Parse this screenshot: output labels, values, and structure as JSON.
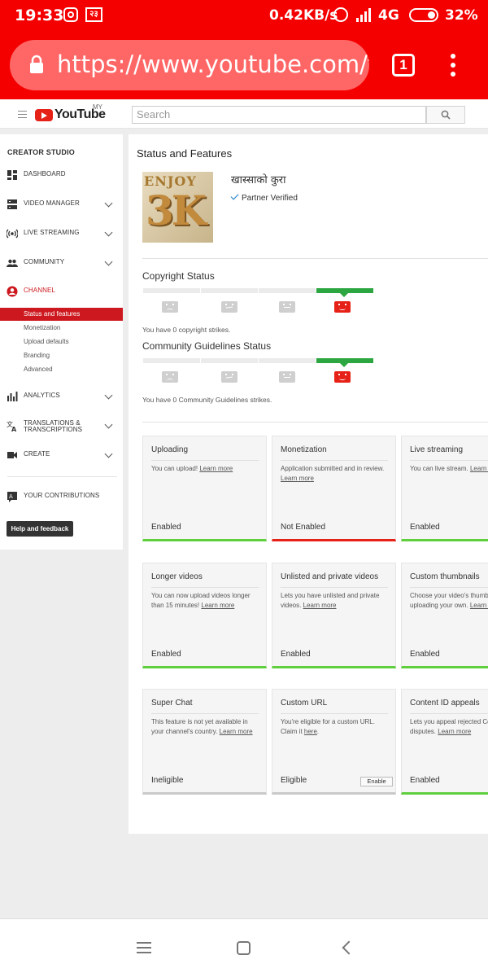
{
  "status_bar": {
    "time": "19:33",
    "carrier_badge": "२३",
    "speed": "0.42KB/s",
    "network": "4G",
    "battery": "32%"
  },
  "browser": {
    "url": "https://www.youtube.com/features",
    "tab_count": "1"
  },
  "yt_header": {
    "logo": "YouTube",
    "region": "MY",
    "search_placeholder": "Search"
  },
  "sidebar": {
    "title": "CREATOR STUDIO",
    "items": [
      {
        "label": "DASHBOARD",
        "icon": "dashboard-icon"
      },
      {
        "label": "VIDEO MANAGER",
        "icon": "video-manager-icon"
      },
      {
        "label": "LIVE STREAMING",
        "icon": "live-icon"
      },
      {
        "label": "COMMUNITY",
        "icon": "community-icon"
      },
      {
        "label": "CHANNEL",
        "icon": "channel-icon"
      },
      {
        "label": "ANALYTICS",
        "icon": "analytics-icon"
      },
      {
        "label": "TRANSLATIONS & TRANSCRIPTIONS",
        "icon": "translate-icon"
      },
      {
        "label": "CREATE",
        "icon": "create-icon"
      },
      {
        "label": "YOUR CONTRIBUTIONS",
        "icon": "contributions-icon"
      }
    ],
    "channel_sub": [
      "Status and features",
      "Monetization",
      "Upload defaults",
      "Branding",
      "Advanced"
    ],
    "help_button": "Help and feedback"
  },
  "main": {
    "title": "Status and Features",
    "avatar_text": {
      "big": "3K",
      "small": "ENJOY"
    },
    "channel_name": "खास्साको कुरा",
    "verified_label": "Partner Verified",
    "copyright": {
      "title": "Copyright Status",
      "note": "You have 0 copyright strikes."
    },
    "community": {
      "title": "Community Guidelines Status",
      "note": "You have 0 Community Guidelines strikes."
    },
    "cards": [
      {
        "title": "Uploading",
        "desc": "You can upload!",
        "link": "Learn more",
        "status": "Enabled",
        "state": "green"
      },
      {
        "title": "Monetization",
        "desc": "Application submitted and in review.",
        "link": "Learn more",
        "status": "Not Enabled",
        "state": "red"
      },
      {
        "title": "Live streaming",
        "desc": "You can live stream.",
        "link": "Learn more",
        "status": "Enabled",
        "state": "green"
      },
      {
        "title": "Longer videos",
        "desc": "You can now upload videos longer than 15 minutes!",
        "link": "Learn more",
        "status": "Enabled",
        "state": "green"
      },
      {
        "title": "Unlisted and private videos",
        "desc": "Lets you have unlisted and private videos.",
        "link": "Learn more",
        "status": "Enabled",
        "state": "green"
      },
      {
        "title": "Custom thumbnails",
        "desc": "Choose your video's thumbnail by uploading your own.",
        "link": "Learn more",
        "status": "Enabled",
        "state": "green"
      },
      {
        "title": "Super Chat",
        "desc": "This feature is not yet available in your channel's country.",
        "link": "Learn more",
        "status": "Ineligible",
        "state": "grey"
      },
      {
        "title": "Custom URL",
        "desc": "You're eligible for a custom URL. Claim it",
        "link": "here",
        "status": "Eligible",
        "state": "grey",
        "button": "Enable"
      },
      {
        "title": "Content ID appeals",
        "desc": "Lets you appeal rejected Content ID disputes.",
        "link": "Learn more",
        "status": "Enabled",
        "state": "green"
      }
    ]
  },
  "colors": {
    "accent": "#f40000",
    "yt_red": "#e62117",
    "success": "#2ba640",
    "active_nav": "#cc181e"
  }
}
